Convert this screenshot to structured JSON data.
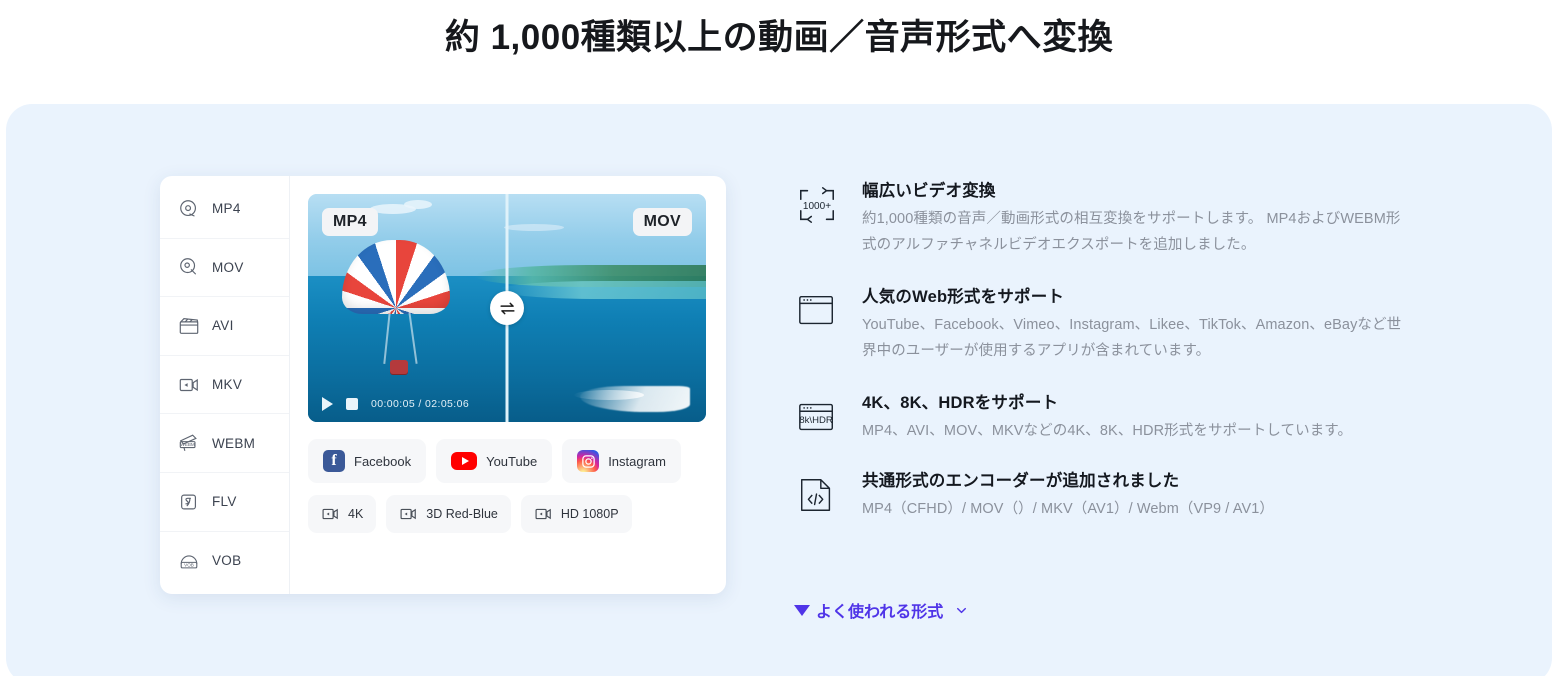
{
  "page_title": "約 1,000種類以上の動画／音声形式へ変換",
  "colors": {
    "panel_bg": "#eaf3fd",
    "link": "#4f34e8",
    "title": "#16181c",
    "desc": "#8b919c"
  },
  "format_list": [
    {
      "label": "MP4",
      "icon": "disc-icon"
    },
    {
      "label": "MOV",
      "icon": "disc-search-icon"
    },
    {
      "label": "AVI",
      "icon": "clapperboard-icon"
    },
    {
      "label": "MKV",
      "icon": "video-camera-icon"
    },
    {
      "label": "WEBM",
      "icon": "webm-megaphone-icon"
    },
    {
      "label": "FLV",
      "icon": "flash-icon"
    },
    {
      "label": "VOB",
      "icon": "vob-dome-icon"
    }
  ],
  "preview": {
    "source_format": "MP4",
    "target_format": "MOV",
    "swap_icon": "swap-arrows-icon",
    "play_icon": "play-icon",
    "stop_icon": "stop-icon",
    "time": "00:00:05 / 02:05:06"
  },
  "share_targets": [
    {
      "label": "Facebook",
      "icon": "facebook-icon",
      "glyph": "f"
    },
    {
      "label": "YouTube",
      "icon": "youtube-icon"
    },
    {
      "label": "Instagram",
      "icon": "instagram-icon"
    }
  ],
  "quality_presets": [
    {
      "label": "4K",
      "icon": "video-camera-icon"
    },
    {
      "label": "3D Red-Blue",
      "icon": "video-camera-icon"
    },
    {
      "label": "HD 1080P",
      "icon": "video-camera-icon"
    }
  ],
  "features": [
    {
      "icon": "conversion-1000-plus-icon",
      "icon_text": "1000+",
      "title": "幅広いビデオ変換",
      "desc": "約1,000種類の音声／動画形式の相互変換をサポートします。 MP4およびWEBM形式のアルファチャネルビデオエクスポートを追加しました。"
    },
    {
      "icon": "browser-window-icon",
      "title": "人気のWeb形式をサポート",
      "desc": "YouTube、Facebook、Vimeo、Instagram、Likee、TikTok、Amazon、eBayなど世界中のユーザーが使用するアプリが含まれています。"
    },
    {
      "icon": "browser-8k-hdr-icon",
      "icon_text": "8k\\HDR",
      "title": "4K、8K、HDRをサポート",
      "desc": "MP4、AVI、MOV、MKVなどの4K、8K、HDR形式をサポートしています。"
    },
    {
      "icon": "code-file-icon",
      "title": "共通形式のエンコーダーが追加されました",
      "desc": "MP4（CFHD）/ MOV（）/ MKV（AV1）/ Webm（VP9 / AV1）"
    }
  ],
  "more_link": {
    "label": "よく使われる形式",
    "caret_icon": "triangle-down-icon",
    "chevron_icon": "chevron-down-icon"
  }
}
